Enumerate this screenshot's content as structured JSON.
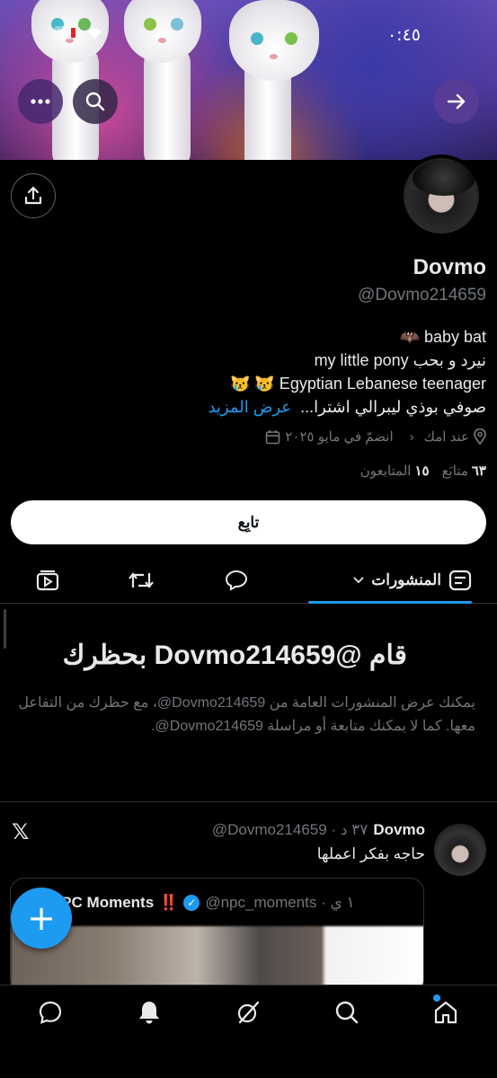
{
  "status_bar": {
    "time": "٠:٤٥",
    "battery": "١٩"
  },
  "header_actions": {
    "more_icon": "more-horizontal-icon",
    "search_icon": "search-icon",
    "forward_icon": "arrow-right-icon",
    "share_icon": "share-icon"
  },
  "profile": {
    "display_name": "Dovmo",
    "handle": "@Dovmo214659",
    "bio_lines": [
      "🦇 baby bat",
      "نيرد و بحب my little pony",
      "😿 😿 Egyptian Lebanese teenager"
    ],
    "bio_last": "صوفي بوذي ليبرالي اشترا...",
    "see_more": "عرض المزيد",
    "location": "عند امك",
    "joined": "انضمّ في مايو ٢٠٢٥",
    "following_count": "٦٣",
    "following_label": "متابَع",
    "followers_count": "١٥",
    "followers_label": "المتابعون",
    "follow_button": "تابِع"
  },
  "tabs": {
    "posts_label": "المنشورات"
  },
  "blocked": {
    "title": "قام @Dovmo214659 بحظرك",
    "description": "يمكنك عرض المنشورات العامة من ‎@Dovmo214659، مع حظرك من التفاعل معها. كما لا يمكنك متابعة أو مراسلة ‎@Dovmo214659."
  },
  "post": {
    "name": "Dovmo",
    "handle_time": "@Dovmo214659 · ٣٧ د",
    "text": "حاجه بفكر اعملها",
    "quote": {
      "emoji": "🗿",
      "name": "NPC Moments",
      "marks": "‼️",
      "handle_time": "@npc_moments · ١ ي"
    }
  },
  "fab_label": "+",
  "accent": "#1d9bf0"
}
